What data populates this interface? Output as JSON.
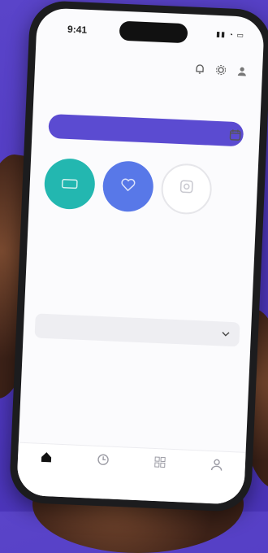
{
  "status_bar": {
    "time": "9:41",
    "icons": "▮▮ ◔ ▭"
  },
  "header": {
    "title": "",
    "subtitle": "",
    "icons": [
      "bell-icon",
      "gear-icon",
      "avatar"
    ]
  },
  "promo": {
    "title": "",
    "subtitle": "",
    "icon": "calendar-icon"
  },
  "primary_button": {
    "label": "",
    "caption": ""
  },
  "shortcuts": {
    "label": "",
    "items": [
      {
        "name": "shortcut-teal",
        "color": "#23b7b0"
      },
      {
        "name": "shortcut-blue",
        "color": "#5878e8"
      },
      {
        "name": "shortcut-add",
        "color": "#ffffff"
      }
    ]
  },
  "details": {
    "label": "",
    "rows": [
      {
        "label": "",
        "value": ""
      },
      {
        "label": "",
        "value": ""
      },
      {
        "label": "",
        "value": ""
      }
    ]
  },
  "dropdown": {
    "value": ""
  },
  "tabbar": {
    "tabs": [
      {
        "label": ""
      },
      {
        "label": ""
      },
      {
        "label": ""
      },
      {
        "label": ""
      }
    ]
  },
  "colors": {
    "accent": "#5b4bd1",
    "background": "#4f38c0"
  }
}
